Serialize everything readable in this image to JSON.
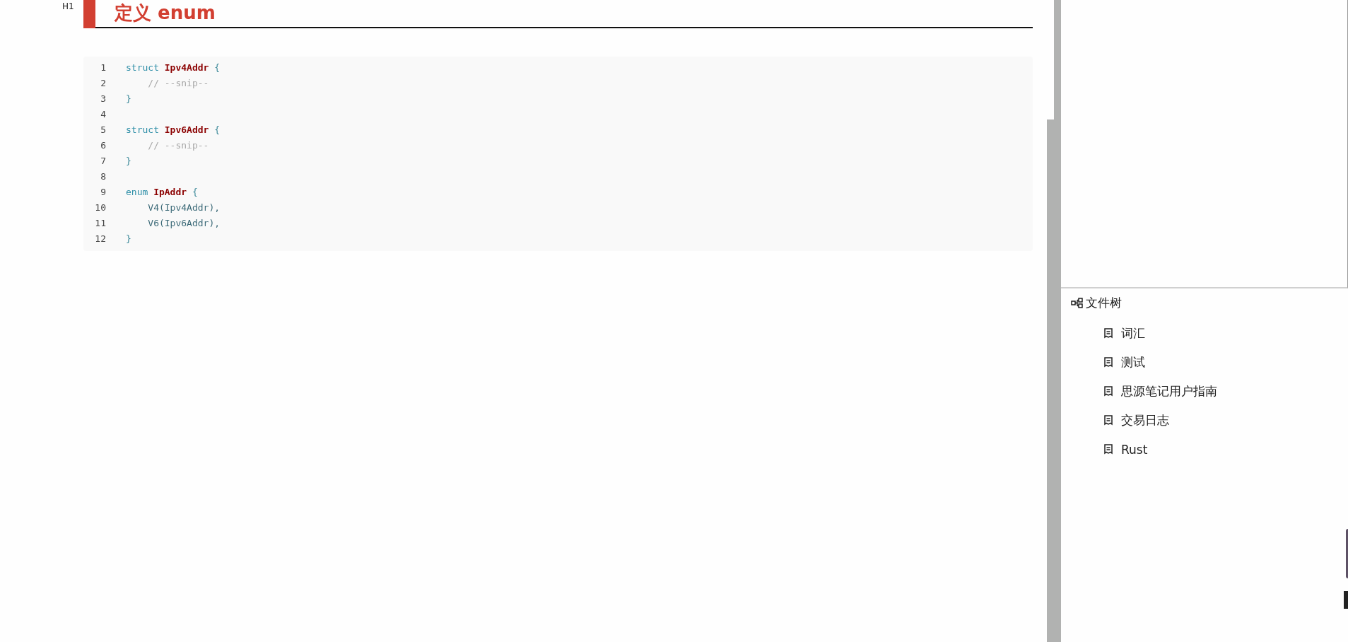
{
  "heading": {
    "level_label": "H1",
    "title": "定义 enum"
  },
  "code": {
    "lines": [
      {
        "number": "1",
        "tokens": [
          {
            "kind": "keyword",
            "text": "struct "
          },
          {
            "kind": "type",
            "text": "Ipv4Addr "
          },
          {
            "kind": "punct",
            "text": "{"
          }
        ]
      },
      {
        "number": "2",
        "tokens": [
          {
            "kind": "comment",
            "text": "    // --snip--"
          }
        ]
      },
      {
        "number": "3",
        "tokens": [
          {
            "kind": "punct",
            "text": "}"
          }
        ]
      },
      {
        "number": "4"
      },
      {
        "number": "5",
        "tokens": [
          {
            "kind": "keyword",
            "text": "struct "
          },
          {
            "kind": "type",
            "text": "Ipv6Addr "
          },
          {
            "kind": "punct",
            "text": "{"
          }
        ]
      },
      {
        "number": "6",
        "tokens": [
          {
            "kind": "comment",
            "text": "    // --snip--"
          }
        ]
      },
      {
        "number": "7",
        "tokens": [
          {
            "kind": "punct",
            "text": "}"
          }
        ]
      },
      {
        "number": "8"
      },
      {
        "number": "9",
        "tokens": [
          {
            "kind": "keyword",
            "text": "enum "
          },
          {
            "kind": "type",
            "text": "IpAddr "
          },
          {
            "kind": "punct",
            "text": "{"
          }
        ]
      },
      {
        "number": "10",
        "tokens": [
          {
            "kind": "plain",
            "text": "    V4(Ipv4Addr),"
          }
        ]
      },
      {
        "number": "11",
        "tokens": [
          {
            "kind": "plain",
            "text": "    V6(Ipv6Addr),"
          }
        ]
      },
      {
        "number": "12",
        "tokens": [
          {
            "kind": "punct",
            "text": "}"
          }
        ]
      }
    ]
  },
  "file_tree": {
    "title": "文件树",
    "items": [
      {
        "label": "词汇"
      },
      {
        "label": "测试"
      },
      {
        "label": "思源笔记用户指南"
      },
      {
        "label": "交易日志"
      },
      {
        "label": "Rust"
      }
    ]
  }
}
